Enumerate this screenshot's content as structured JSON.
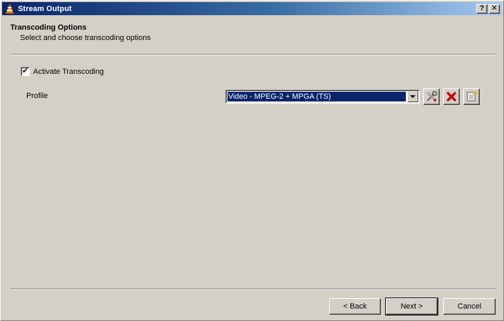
{
  "window": {
    "title": "Stream Output"
  },
  "header": {
    "title": "Transcoding Options",
    "subtitle": "Select and choose transcoding options"
  },
  "transcoding": {
    "checkbox_label": "Activate Transcoding",
    "checked": true,
    "check_mark": "✔"
  },
  "profile": {
    "label": "Profile",
    "selected": "Video - MPEG-2 + MPGA (TS)"
  },
  "profile_actions": [
    "edit-profile-icon",
    "delete-profile-icon",
    "new-profile-icon"
  ],
  "footer": {
    "back_label": "< Back",
    "next_label": "Next >",
    "cancel_label": "Cancel"
  },
  "titlebar_buttons": {
    "help": "?",
    "close": "✕"
  },
  "colors": {
    "titlebar_start": "#0a246a",
    "titlebar_end": "#a6caf0",
    "dialog_bg": "#d4d0c8",
    "selection": "#0a246a",
    "delete_red": "#cc0000"
  }
}
